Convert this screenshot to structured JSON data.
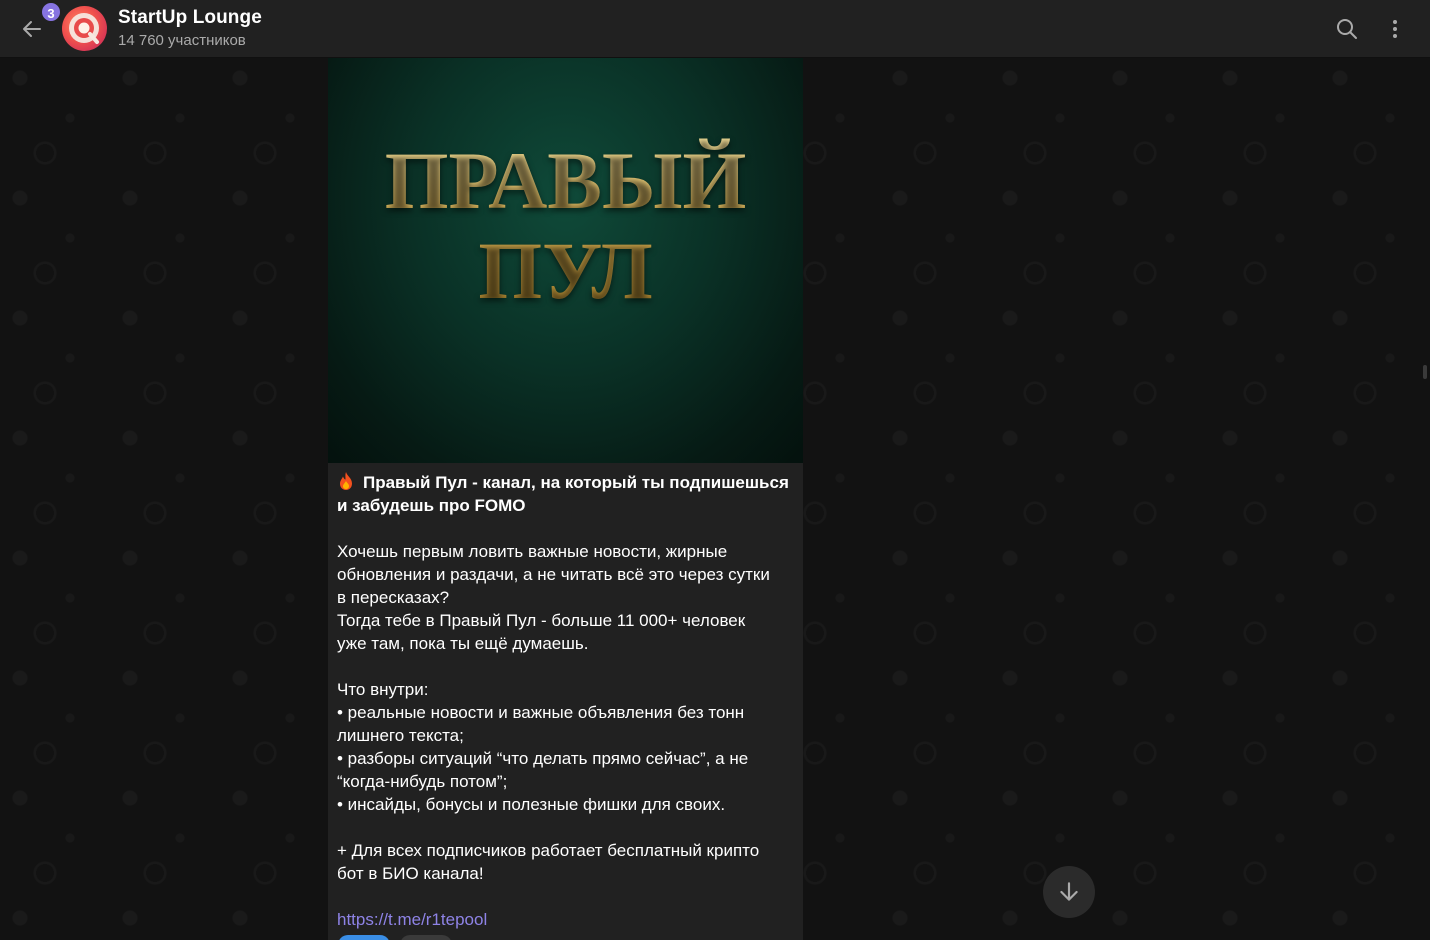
{
  "header": {
    "unread_count": "3",
    "title": "StartUp Lounge",
    "subtitle": "14 760 участников"
  },
  "message": {
    "image_title": "ПРАВЫЙ\nПУЛ",
    "headline_line1": "Правый Пул - канал, на который ты подпишешься",
    "headline_line2": "и забудешь про FOMO",
    "para1_line1": "Хочешь первым ловить важные новости, жирные",
    "para1_line2": "обновления и раздачи, а не читать всё это через сутки",
    "para1_line3": "в пересказах?",
    "para2_line1": "Тогда тебе в Правый Пул - больше 11 000+ человек",
    "para2_line2": "уже там, пока ты ещё думаешь.",
    "inside_title": "Что внутри:",
    "bullet1_line1": "• реальные новости и важные объявления без тонн",
    "bullet1_line2": "лишнего текста;",
    "bullet2_line1": "• разборы ситуаций “что делать прямо сейчас”, а не",
    "bullet2_line2": "“когда-нибудь потом”;",
    "bullet3": "• инсайды, бонусы и полезные фишки для своих.",
    "promo_line1": "+ Для всех подписчиков работает бесплатный крипто",
    "promo_line2": "бот в БИО канала!",
    "link": "https://t.me/r1tepool"
  },
  "colors": {
    "accent": "#8774e1",
    "link": "#8e83e6",
    "header_bg": "#212121",
    "bubble_bg": "#212121",
    "gold": "#d4b65c"
  },
  "icons": {
    "back": "arrow-left-icon",
    "search": "search-icon",
    "menu": "more-vertical-icon",
    "fire": "fire-emoji-icon",
    "scroll_down": "arrow-down-icon"
  }
}
